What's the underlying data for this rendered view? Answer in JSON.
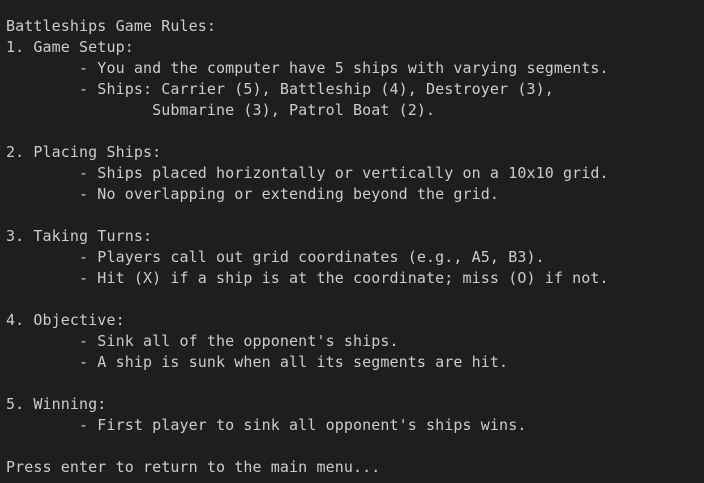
{
  "terminal": {
    "title_line": "Battleships Game Rules:",
    "sections": [
      {
        "heading": "1. Game Setup:",
        "lines": [
          "        - You and the computer have 5 ships with varying segments.",
          "        - Ships: Carrier (5), Battleship (4), Destroyer (3),",
          "                Submarine (3), Patrol Boat (2)."
        ]
      },
      {
        "heading": "2. Placing Ships:",
        "lines": [
          "        - Ships placed horizontally or vertically on a 10x10 grid.",
          "        - No overlapping or extending beyond the grid."
        ]
      },
      {
        "heading": "3. Taking Turns:",
        "lines": [
          "        - Players call out grid coordinates (e.g., A5, B3).",
          "        - Hit (X) if a ship is at the coordinate; miss (O) if not."
        ]
      },
      {
        "heading": "4. Objective:",
        "lines": [
          "        - Sink all of the opponent's ships.",
          "        - A ship is sunk when all its segments are hit."
        ]
      },
      {
        "heading": "5. Winning:",
        "lines": [
          "        - First player to sink all opponent's ships wins."
        ]
      }
    ],
    "prompt": "Press enter to return to the main menu..."
  },
  "colors": {
    "background": "#1e1e1e",
    "text": "#cccccc"
  }
}
